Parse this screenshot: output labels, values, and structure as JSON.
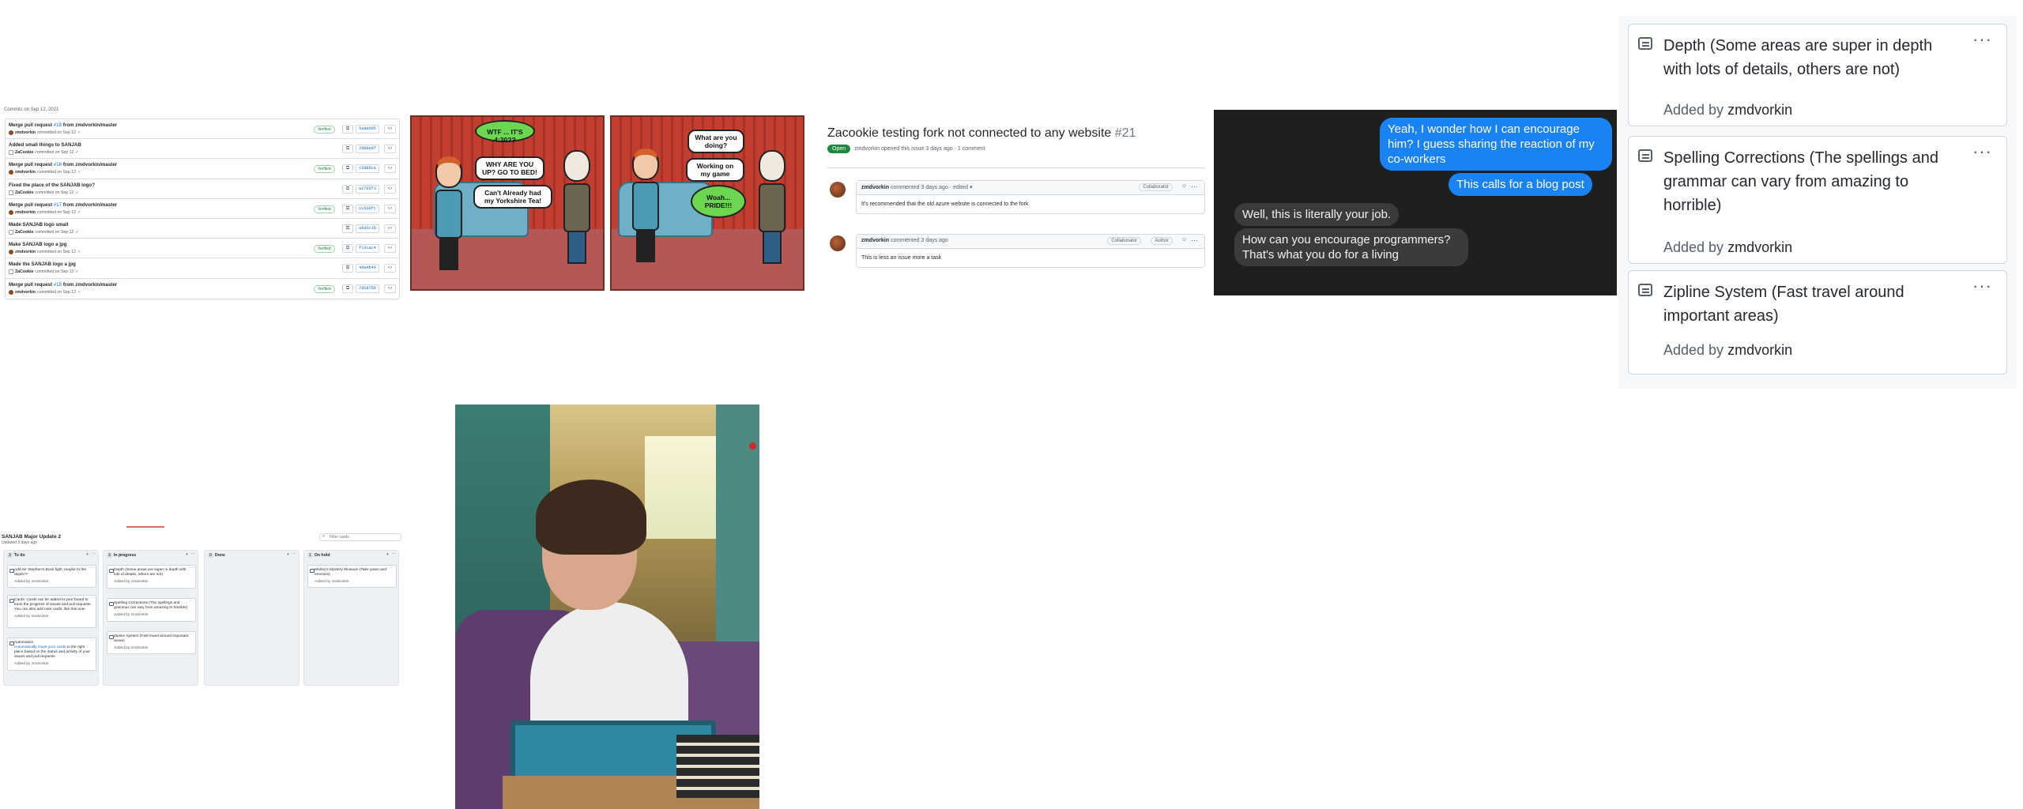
{
  "commits": {
    "date_heading": "Commits on Sep 12, 2021",
    "verified_label": "Verified",
    "items": [
      {
        "pre": "Merge pull request ",
        "ref": "#18",
        "post": " from zmdvorkin/master",
        "author": "zmdvorkin",
        "action": "committed on Sep 12",
        "verified": true,
        "sha": "5a9e0d5"
      },
      {
        "pre": "Added small things to SANJAB",
        "ref": "",
        "post": "",
        "author": "ZaCookie",
        "action": "committed on Sep 12",
        "verified": false,
        "sha": "2d98e6f"
      },
      {
        "pre": "Merge pull request ",
        "ref": "#16",
        "post": " from zmdvorkin/master",
        "author": "zmdvorkin",
        "action": "committed on Sep 12",
        "verified": true,
        "sha": "c5885ca"
      },
      {
        "pre": "Fixed the place of the SANJAB logo?",
        "ref": "",
        "post": "",
        "author": "ZaCookie",
        "action": "committed on Sep 12",
        "verified": false,
        "sha": "a2705f3"
      },
      {
        "pre": "Merge pull request ",
        "ref": "#17",
        "post": " from zmdvorkin/master",
        "author": "zmdvorkin",
        "action": "committed on Sep 12",
        "verified": true,
        "sha": "1c638fc"
      },
      {
        "pre": "Made SANJAB logo small",
        "ref": "",
        "post": "",
        "author": "ZaCookie",
        "action": "committed on Sep 12",
        "verified": false,
        "sha": "a6a5c1b"
      },
      {
        "pre": "Make SANJAB logo a jpg",
        "ref": "",
        "post": "",
        "author": "zmdvorkin",
        "action": "committed on Sep 12",
        "verified": true,
        "sha": "f13cac4"
      },
      {
        "pre": "Made the SANJAB logo a jpg",
        "ref": "",
        "post": "",
        "author": "ZaCookie",
        "action": "committed on Sep 12",
        "verified": false,
        "sha": "4da4b46"
      },
      {
        "pre": "Merge pull request ",
        "ref": "#15",
        "post": " from zmdvorkin/master",
        "author": "zmdvorkin",
        "action": "committed on Sep 12",
        "verified": true,
        "sha": "7d2875b"
      }
    ]
  },
  "comic": {
    "panel1": {
      "bubble_green": "WTF ... IT'S 4:30??",
      "bubble_1": "WHY ARE YOU UP? GO TO BED!",
      "bubble_2": "Can't Already had my Yorkshire Tea!"
    },
    "panel2": {
      "bubble_1": "What are you doing?",
      "bubble_2": "Working on my game",
      "bubble_green": "Woah... PRIDE!!!"
    }
  },
  "issue": {
    "title": "Zacookie testing fork not connected to any website",
    "number": "#21",
    "state": "Open",
    "subtitle": "zmdvorkin opened this issue 3 days ago · 1 comment",
    "comments": [
      {
        "author": "zmdvorkin",
        "meta": "commented 3 days ago · edited ▾",
        "badges": [
          "Collaborator"
        ],
        "body": "It's recommended that the old azure website is connected to the fork"
      },
      {
        "author": "zmdvorkin",
        "meta": "commented 3 days ago",
        "badges": [
          "Collaborator",
          "Author"
        ],
        "body": "This is less an issue more a task"
      }
    ]
  },
  "chat": {
    "messages": [
      {
        "side": "right",
        "text": "Yeah, I wonder how I can encourage him? I guess sharing the reaction of my co-workers"
      },
      {
        "side": "right",
        "text": "This calls for a blog post"
      },
      {
        "side": "left",
        "text": "Well, this is literally your job."
      },
      {
        "side": "left",
        "text": "How can you encourage programmers? That's what you do for a living"
      }
    ]
  },
  "cards": {
    "added_prefix": "Added by",
    "items": [
      {
        "title": "Depth (Some areas are super in depth with lots of details, others are not)",
        "author": "zmdvorkin"
      },
      {
        "title": "Spelling Corrections (The spellings and grammar can vary from amazing to horrible)",
        "author": "zmdvorkin"
      },
      {
        "title": "Zipline System (Fast travel around important areas)",
        "author": "zmdvorkin"
      }
    ]
  },
  "board": {
    "title": "SANJAB Major Update 2",
    "subtitle": "Updated 3 days ago",
    "filter_placeholder": "Filter cards",
    "columns": [
      {
        "name": "To do",
        "count": "3",
        "cards": [
          {
            "text": "Add Sir Stephen's Boss fight, maybe to the depth??",
            "by": "Added by zmdvorkin"
          },
          {
            "text": "Cards: Cards can be added to your board to track the progress of issues and pull requests. You can also add note cards, like this one!",
            "by": "Added by zmdvorkin"
          },
          {
            "text": "Automation: Automatically move your cards to the right place based on the status and activity of your issues and pull requests.",
            "link": "Automatically move your cards",
            "by": "Added by zmdvorkin"
          }
        ]
      },
      {
        "name": "In progress",
        "count": "3",
        "cards": [
          {
            "text": "Depth (Some areas are super in depth with lots of details, others are not)",
            "by": "Added by zmdvorkin"
          },
          {
            "text": "Spelling Corrections (The spellings and grammar can vary from amazing to horrible)",
            "by": "Added by zmdvorkin"
          },
          {
            "text": "Zipline System (Fast travel around important areas)",
            "by": "Added by zmdvorkin"
          }
        ]
      },
      {
        "name": "Done",
        "count": "0",
        "cards": []
      },
      {
        "name": "On hold",
        "count": "1",
        "cards": [
          {
            "text": "Morley's Mystery Museum (Take years and enemies)",
            "by": "Added by zmdvorkin"
          }
        ]
      }
    ]
  }
}
